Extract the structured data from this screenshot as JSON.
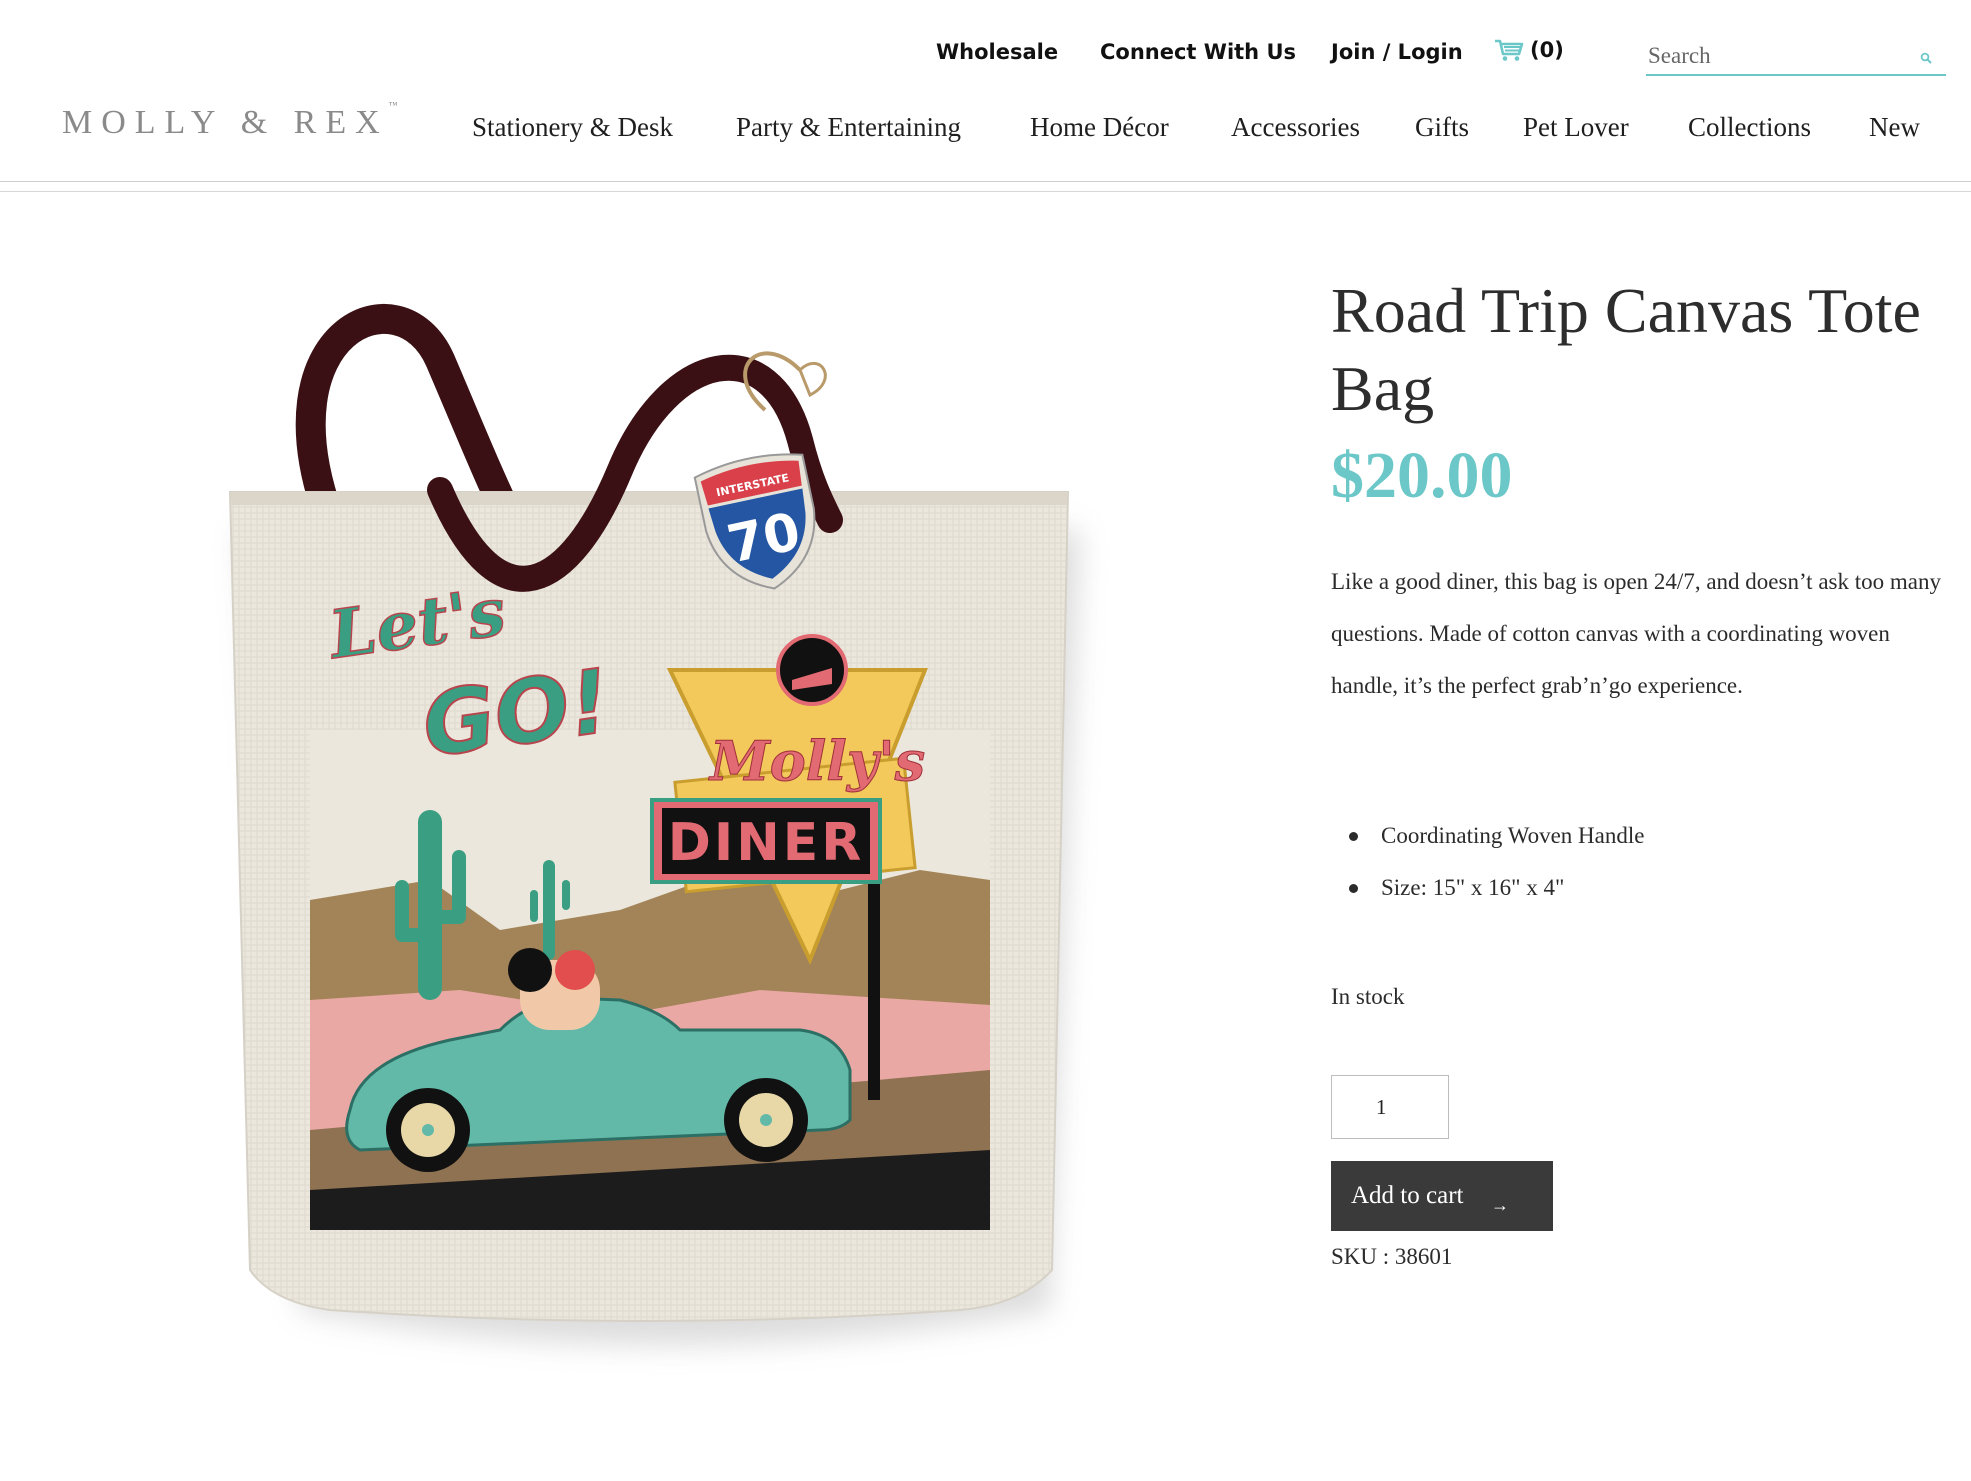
{
  "header": {
    "utility_links": [
      "Wholesale",
      "Connect With Us",
      "Join / Login"
    ],
    "cart": {
      "icon": "cart-icon",
      "count": "(0)"
    },
    "search": {
      "placeholder": "Search",
      "icon": "search-icon"
    },
    "logo": {
      "text": "MOLLY & REX",
      "trademark": "™"
    },
    "nav": [
      "Stationery & Desk",
      "Party & Entertaining",
      "Home Décor",
      "Accessories",
      "Gifts",
      "Pet Lover",
      "Collections",
      "New"
    ]
  },
  "product": {
    "image_text": {
      "slogan_top": "Let's",
      "slogan_bottom": "GO!",
      "shield_top": "INTERSTATE",
      "shield_number": "70",
      "sign_script": "Molly's",
      "sign_word": "DINER"
    },
    "title": "Road Trip Canvas Tote Bag",
    "price": "$20.00",
    "description": "Like a good diner, this bag is open 24/7, and doesn’t ask too many questions. Made of cotton canvas with a coordinating woven handle, it’s the perfect grab’n’go experience.",
    "features": [
      "Coordinating Woven Handle",
      "Size: 15\" x 16\" x 4\""
    ],
    "stock": "In stock",
    "quantity": "1",
    "add_to_cart": "Add to cart",
    "add_to_cart_arrow": "→",
    "sku": "SKU : 38601"
  },
  "colors": {
    "accent": "#6cc7c8",
    "button": "#3a3a3a",
    "canvas": "#ece8df",
    "handle": "#3b1014"
  }
}
